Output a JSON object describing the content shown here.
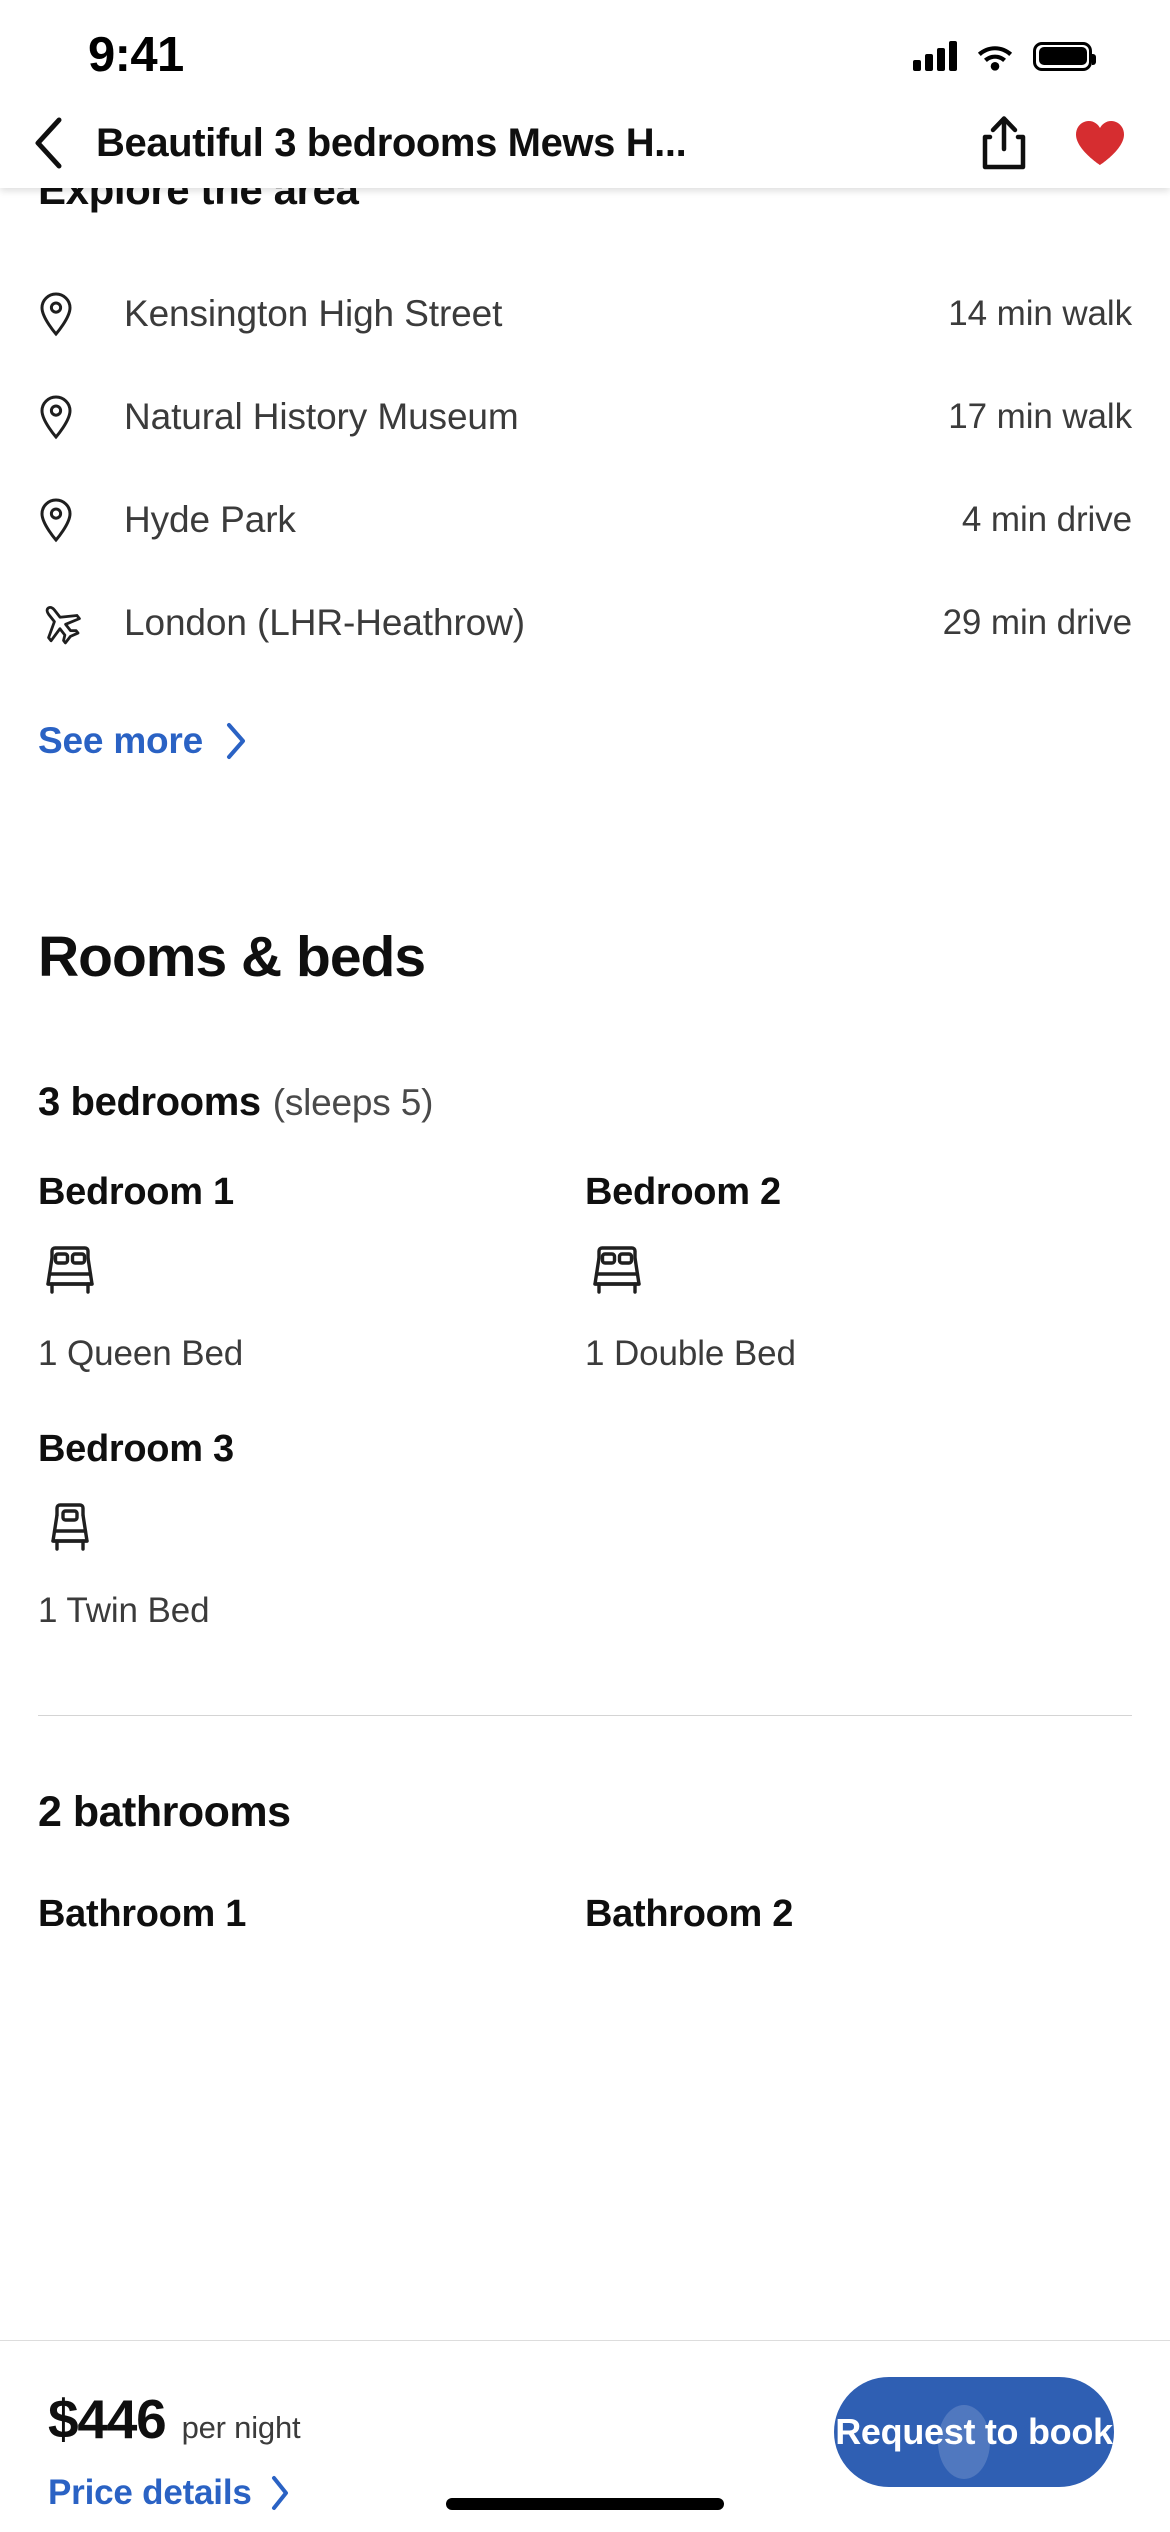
{
  "status_bar": {
    "time": "9:41",
    "cellular_icon": "signal-bars-icon",
    "wifi_icon": "wifi-icon",
    "battery_icon": "battery-full-icon"
  },
  "nav_bar": {
    "back_icon": "chevron-left-icon",
    "title": "Beautiful 3 bedrooms Mews H...",
    "share_icon": "share-icon",
    "favorite_icon": "heart-filled-icon",
    "favorite_color": "#d62d30"
  },
  "explore": {
    "title": "Explore the area",
    "places": [
      {
        "icon": "map-pin-icon",
        "name": "Kensington High Street",
        "distance": "14 min walk"
      },
      {
        "icon": "map-pin-icon",
        "name": "Natural History Museum",
        "distance": "17 min walk"
      },
      {
        "icon": "map-pin-icon",
        "name": "Hyde Park",
        "distance": "4 min drive"
      },
      {
        "icon": "airplane-icon",
        "name": "London (LHR-Heathrow)",
        "distance": "29 min drive"
      }
    ],
    "see_more_label": "See more",
    "see_more_icon": "chevron-right-icon"
  },
  "rooms_and_beds": {
    "title": "Rooms & beds",
    "bedrooms_count_label": "3 bedrooms",
    "sleeps_label": "(sleeps 5)",
    "bedrooms": [
      {
        "title": "Bedroom 1",
        "icon": "double-bed-icon",
        "beds": "1 Queen Bed"
      },
      {
        "title": "Bedroom 2",
        "icon": "double-bed-icon",
        "beds": "1 Double Bed"
      },
      {
        "title": "Bedroom 3",
        "icon": "single-bed-icon",
        "beds": "1 Twin Bed"
      }
    ],
    "bathrooms_count_label": "2 bathrooms",
    "bathrooms": [
      {
        "title": "Bathroom 1"
      },
      {
        "title": "Bathroom 2"
      }
    ]
  },
  "booking_bar": {
    "price_amount": "$446",
    "price_unit": "per night",
    "price_details_label": "Price details",
    "price_details_icon": "chevron-right-icon",
    "book_button_label": "Request to book",
    "book_button_color": "#2f5fb3",
    "link_color": "#2a62c4"
  }
}
